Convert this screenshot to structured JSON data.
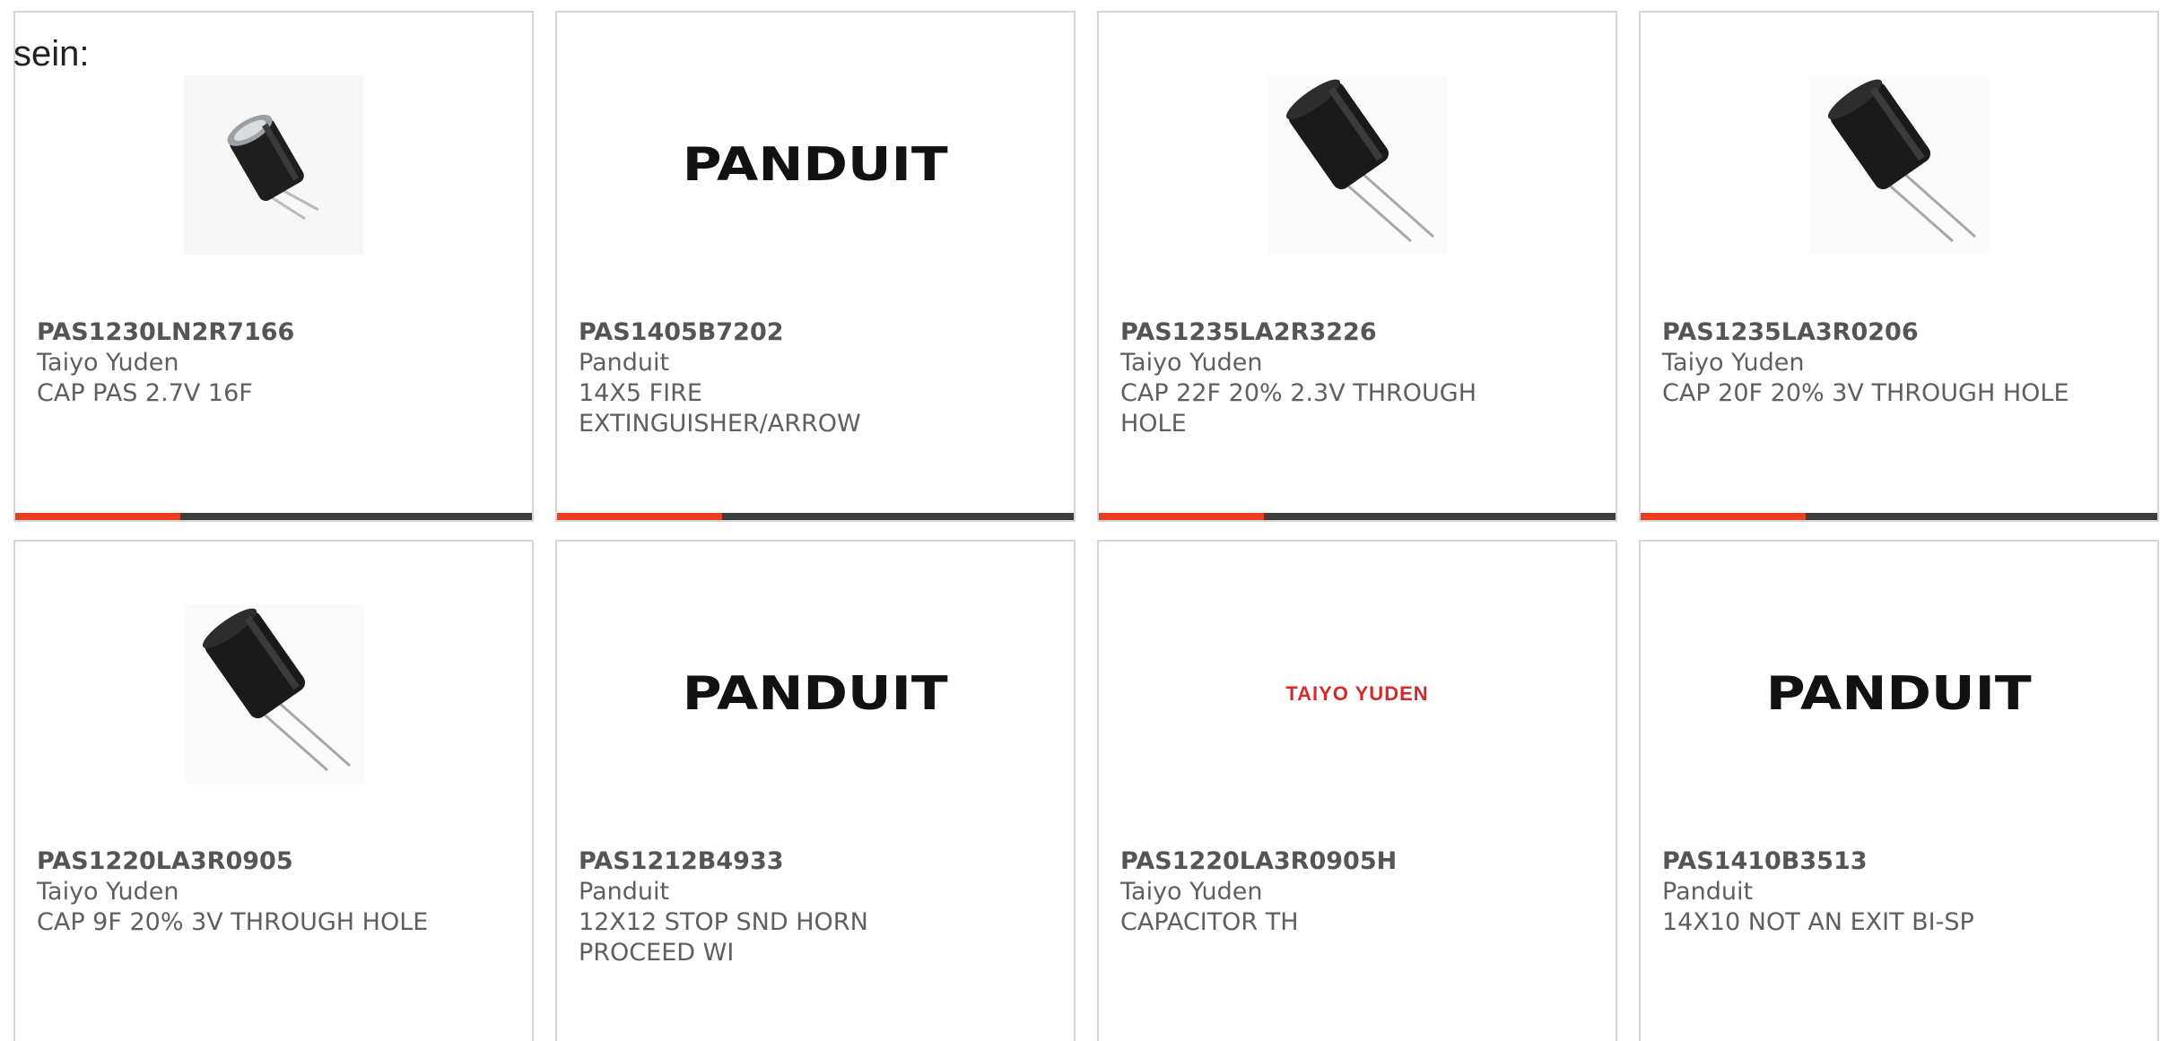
{
  "intro_text": "sein:",
  "colors": {
    "accent": "#e8401c",
    "bar": "#3d3d3d",
    "taiyo_red": "#d62a2a"
  },
  "products": [
    {
      "part": "PAS1230LN2R7166",
      "mfr": "Taiyo Yuden",
      "desc": "CAP PAS 2.7V 16F",
      "image": "capacitor-small",
      "logo": ""
    },
    {
      "part": "PAS1405B7202",
      "mfr": "Panduit",
      "desc": "14X5 FIRE EXTINGUISHER/ARROW",
      "image": "panduit-logo",
      "logo": "PANDUIT"
    },
    {
      "part": "PAS1235LA2R3226",
      "mfr": "Taiyo Yuden",
      "desc": "CAP 22F 20% 2.3V THROUGH HOLE",
      "image": "capacitor",
      "logo": ""
    },
    {
      "part": "PAS1235LA3R0206",
      "mfr": "Taiyo Yuden",
      "desc": "CAP 20F 20% 3V THROUGH HOLE",
      "image": "capacitor",
      "logo": ""
    },
    {
      "part": "PAS1220LA3R0905",
      "mfr": "Taiyo Yuden",
      "desc": "CAP 9F 20% 3V THROUGH HOLE",
      "image": "capacitor",
      "logo": ""
    },
    {
      "part": "PAS1212B4933",
      "mfr": "Panduit",
      "desc": "12X12 STOP SND HORN PROCEED WI",
      "image": "panduit-logo",
      "logo": "PANDUIT"
    },
    {
      "part": "PAS1220LA3R0905H",
      "mfr": "Taiyo Yuden",
      "desc": "CAPACITOR TH",
      "image": "taiyo-yuden-logo",
      "logo": "TAIYO YUDEN"
    },
    {
      "part": "PAS1410B3513",
      "mfr": "Panduit",
      "desc": "14X10 NOT AN EXIT BI-SP",
      "image": "panduit-logo",
      "logo": "PANDUIT"
    }
  ]
}
